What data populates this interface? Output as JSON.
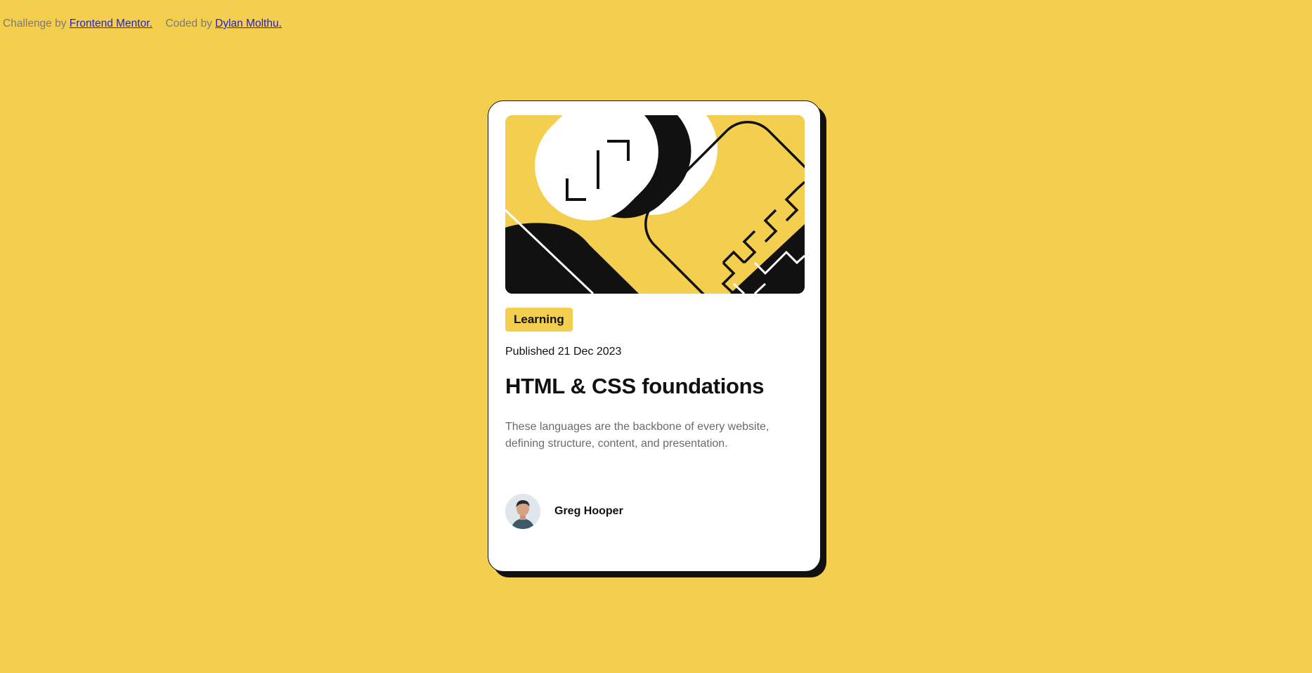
{
  "attribution": {
    "challenge_prefix": "Challenge by",
    "challenge_link": "Frontend Mentor.",
    "coded_prefix": "Coded by",
    "coded_link": "Dylan Molthu."
  },
  "card": {
    "tag": "Learning",
    "published": "Published 21 Dec 2023",
    "title": "HTML & CSS foundations",
    "description": "These languages are the backbone of every website, defining structure, content, and presentation.",
    "author": {
      "name": "Greg Hooper",
      "avatar_icon": "person-portrait-icon"
    },
    "hero_icon": "abstract-illustration"
  },
  "colors": {
    "background": "#F4CE4E",
    "card": "#FFFFFF",
    "ink": "#111111",
    "muted": "#6B6B6B",
    "link": "#2222CC"
  }
}
